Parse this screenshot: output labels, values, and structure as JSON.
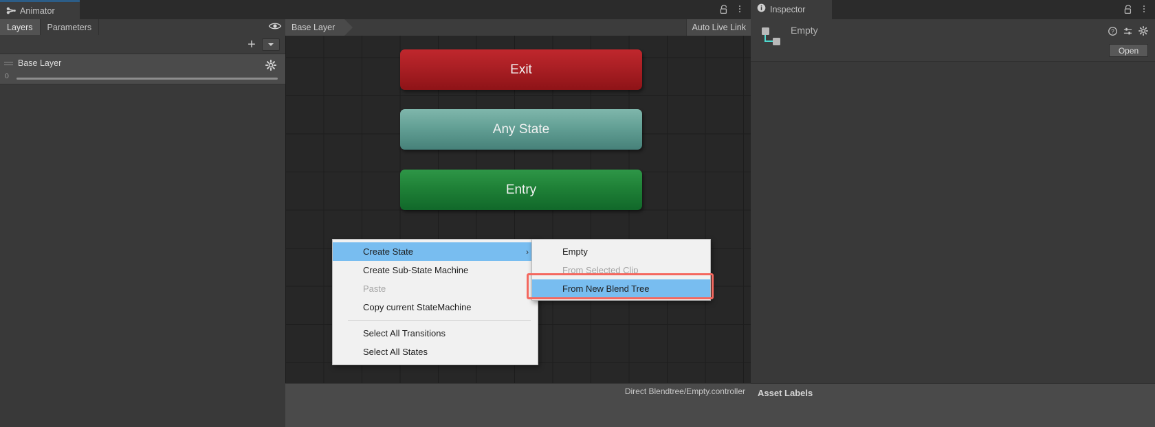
{
  "animator": {
    "tab_label": "Animator",
    "tab_icon": "animator-bone-icon",
    "subtabs": [
      {
        "label": "Layers",
        "active": true
      },
      {
        "label": "Parameters",
        "active": false
      }
    ],
    "toolbar": {
      "add_label": "+",
      "dropdown_icon": "chevron-down-icon",
      "eye_icon": "eye-visibility-icon"
    },
    "layer": {
      "name": "Base Layer",
      "weight_value": "0",
      "gear_icon": "gear-icon",
      "grip_icon": "drag-handle-icon"
    }
  },
  "graph": {
    "breadcrumb": "Base Layer",
    "auto_live_link": "Auto Live Link",
    "status_text": "Direct Blendtree/Empty.controller",
    "nodes": [
      {
        "label": "Exit",
        "color": "#aa1f24"
      },
      {
        "label": "Any State",
        "color": "#63a095"
      },
      {
        "label": "Entry",
        "color": "#1f8137"
      }
    ]
  },
  "context_menu": {
    "items": [
      {
        "label": "Create State",
        "selected": true,
        "disabled": false,
        "submenu": true,
        "separator_after": false
      },
      {
        "label": "Create Sub-State Machine",
        "selected": false,
        "disabled": false,
        "submenu": false,
        "separator_after": false
      },
      {
        "label": "Paste",
        "selected": false,
        "disabled": true,
        "submenu": false,
        "separator_after": false
      },
      {
        "label": "Copy current StateMachine",
        "selected": false,
        "disabled": false,
        "submenu": false,
        "separator_after": true
      },
      {
        "label": "Select All Transitions",
        "selected": false,
        "disabled": false,
        "submenu": false,
        "separator_after": false
      },
      {
        "label": "Select All States",
        "selected": false,
        "disabled": false,
        "submenu": false,
        "separator_after": false
      }
    ],
    "submenu_arrow": "›",
    "submenu": {
      "items": [
        {
          "label": "Empty",
          "selected": false,
          "disabled": false,
          "highlighted": false
        },
        {
          "label": "From Selected Clip",
          "selected": false,
          "disabled": true,
          "highlighted": false
        },
        {
          "label": "From New Blend Tree",
          "selected": true,
          "disabled": false,
          "highlighted": true
        }
      ],
      "highlight_color": "#f4685f",
      "selection_color": "#78bdf0"
    }
  },
  "inspector": {
    "tab_label": "Inspector",
    "tab_icon": "info-circle-icon",
    "title": "Empty",
    "asset_icon": "animator-controller-icon",
    "open_label": "Open",
    "header_icons": [
      {
        "name": "help-icon"
      },
      {
        "name": "preset-icon"
      },
      {
        "name": "gear-icon"
      }
    ],
    "asset_labels_title": "Asset Labels",
    "lock_icon": "lock-open-icon",
    "kebab_icon": "more-options-icon"
  }
}
